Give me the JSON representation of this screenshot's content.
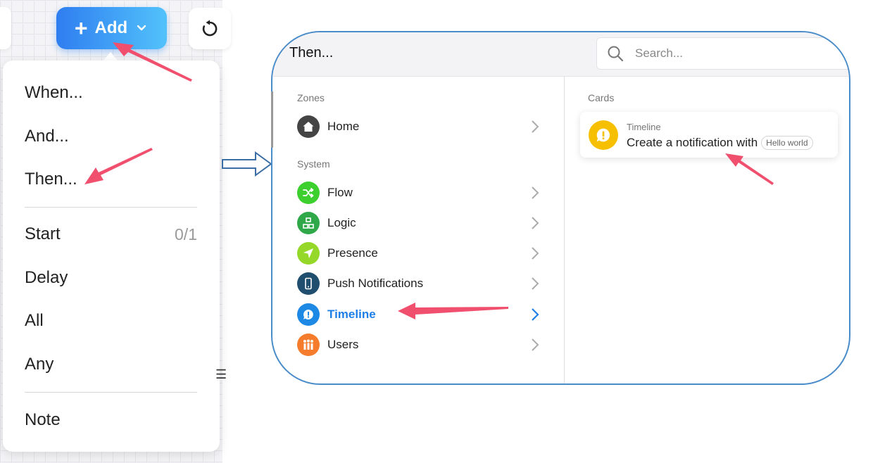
{
  "toolbar": {
    "add_label": "Add",
    "add_icon": "plus-icon",
    "dropdown_icon": "chevron-down-icon",
    "refresh_icon": "refresh-icon"
  },
  "add_menu": {
    "group1": [
      {
        "label": "When..."
      },
      {
        "label": "And..."
      },
      {
        "label": "Then..."
      }
    ],
    "group2": [
      {
        "label": "Start",
        "count": "0/1"
      },
      {
        "label": "Delay"
      },
      {
        "label": "All"
      },
      {
        "label": "Any"
      }
    ],
    "group3": [
      {
        "label": "Note"
      }
    ]
  },
  "modal": {
    "title": "Then...",
    "search_placeholder": "Search...",
    "zones_label": "Zones",
    "zones": [
      {
        "label": "Home",
        "icon": "home-icon",
        "color": "#444444"
      }
    ],
    "system_label": "System",
    "system": [
      {
        "label": "Flow",
        "icon": "shuffle-icon",
        "color": "#3ccf2e"
      },
      {
        "label": "Logic",
        "icon": "blocks-icon",
        "color": "#2fa84a"
      },
      {
        "label": "Presence",
        "icon": "location-arrow-icon",
        "color": "#96d82a"
      },
      {
        "label": "Push Notifications",
        "icon": "phone-icon",
        "color": "#1f4e6e"
      },
      {
        "label": "Timeline",
        "icon": "exclamation-bubble-icon",
        "color": "#1e88e5",
        "active": true
      },
      {
        "label": "Users",
        "icon": "users-icon",
        "color": "#f47c2c"
      }
    ],
    "cards_label": "Cards",
    "card": {
      "subtitle": "Timeline",
      "text": "Create a notification with",
      "pill": "Hello world",
      "icon": "exclamation-bubble-icon",
      "icon_color": "#f6c000"
    }
  },
  "colors": {
    "accent": "#1e88e5",
    "annotation_arrow": "#f0506e",
    "modal_border": "#4a8cc9"
  }
}
